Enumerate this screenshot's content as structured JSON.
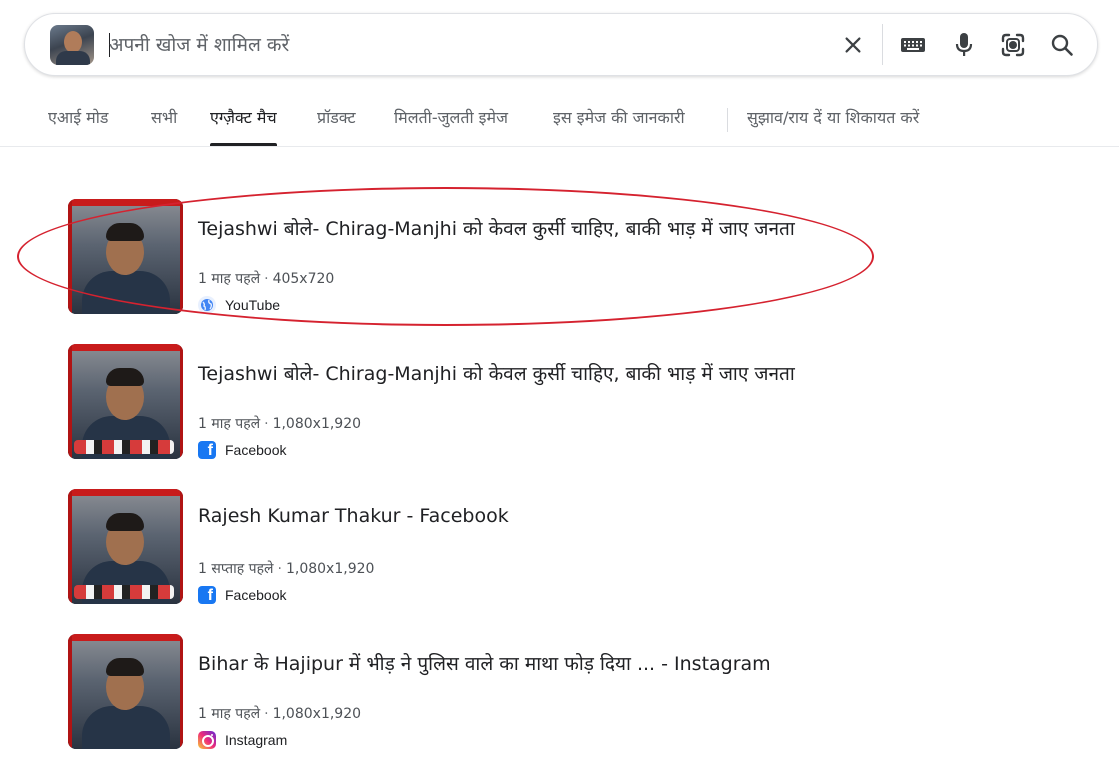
{
  "search": {
    "placeholder": "अपनी खोज में शामिल करें",
    "value": ""
  },
  "search_icons": {
    "clear": "close-icon",
    "keyboard": "keyboard-icon",
    "voice": "microphone-icon",
    "lens": "google-lens-icon",
    "search": "search-icon"
  },
  "tabs": [
    {
      "label": "एआई मोड",
      "active": false
    },
    {
      "label": "सभी",
      "active": false
    },
    {
      "label": "एग्ज़ैक्ट मैच",
      "active": true
    },
    {
      "label": "प्रॉडक्ट",
      "active": false
    },
    {
      "label": "मिलती-जुलती इमेज",
      "active": false
    },
    {
      "label": "इस इमेज की जानकारी",
      "active": false
    },
    {
      "label": "सुझाव/राय दें या शिकायत करें",
      "active": false
    }
  ],
  "results": [
    {
      "title": "Tejashwi बोले- Chirag-Manjhi को केवल कुर्सी चाहिए, बाकी भाड़ में जाए जनता",
      "time": "1 माह पहले",
      "dimensions": "405x720",
      "source": "YouTube",
      "source_icon": "globe-icon"
    },
    {
      "title": "Tejashwi बोले- Chirag-Manjhi को केवल कुर्सी चाहिए, बाकी भाड़ में जाए जनता",
      "time": "1 माह पहले",
      "dimensions": "1,080x1,920",
      "source": "Facebook",
      "source_icon": "facebook-icon"
    },
    {
      "title": "Rajesh Kumar Thakur - Facebook",
      "time": "1 सप्ताह पहले",
      "dimensions": "1,080x1,920",
      "source": "Facebook",
      "source_icon": "facebook-icon"
    },
    {
      "title": "Bihar के Hajipur में भीड़ ने पुलिस वाले का माथा फोड़ दिया ... - Instagram",
      "time": "1 माह पहले",
      "dimensions": "1,080x1,920",
      "source": "Instagram",
      "source_icon": "instagram-icon"
    }
  ],
  "colors": {
    "highlight": "#d5222f",
    "facebook": "#1877f2"
  }
}
